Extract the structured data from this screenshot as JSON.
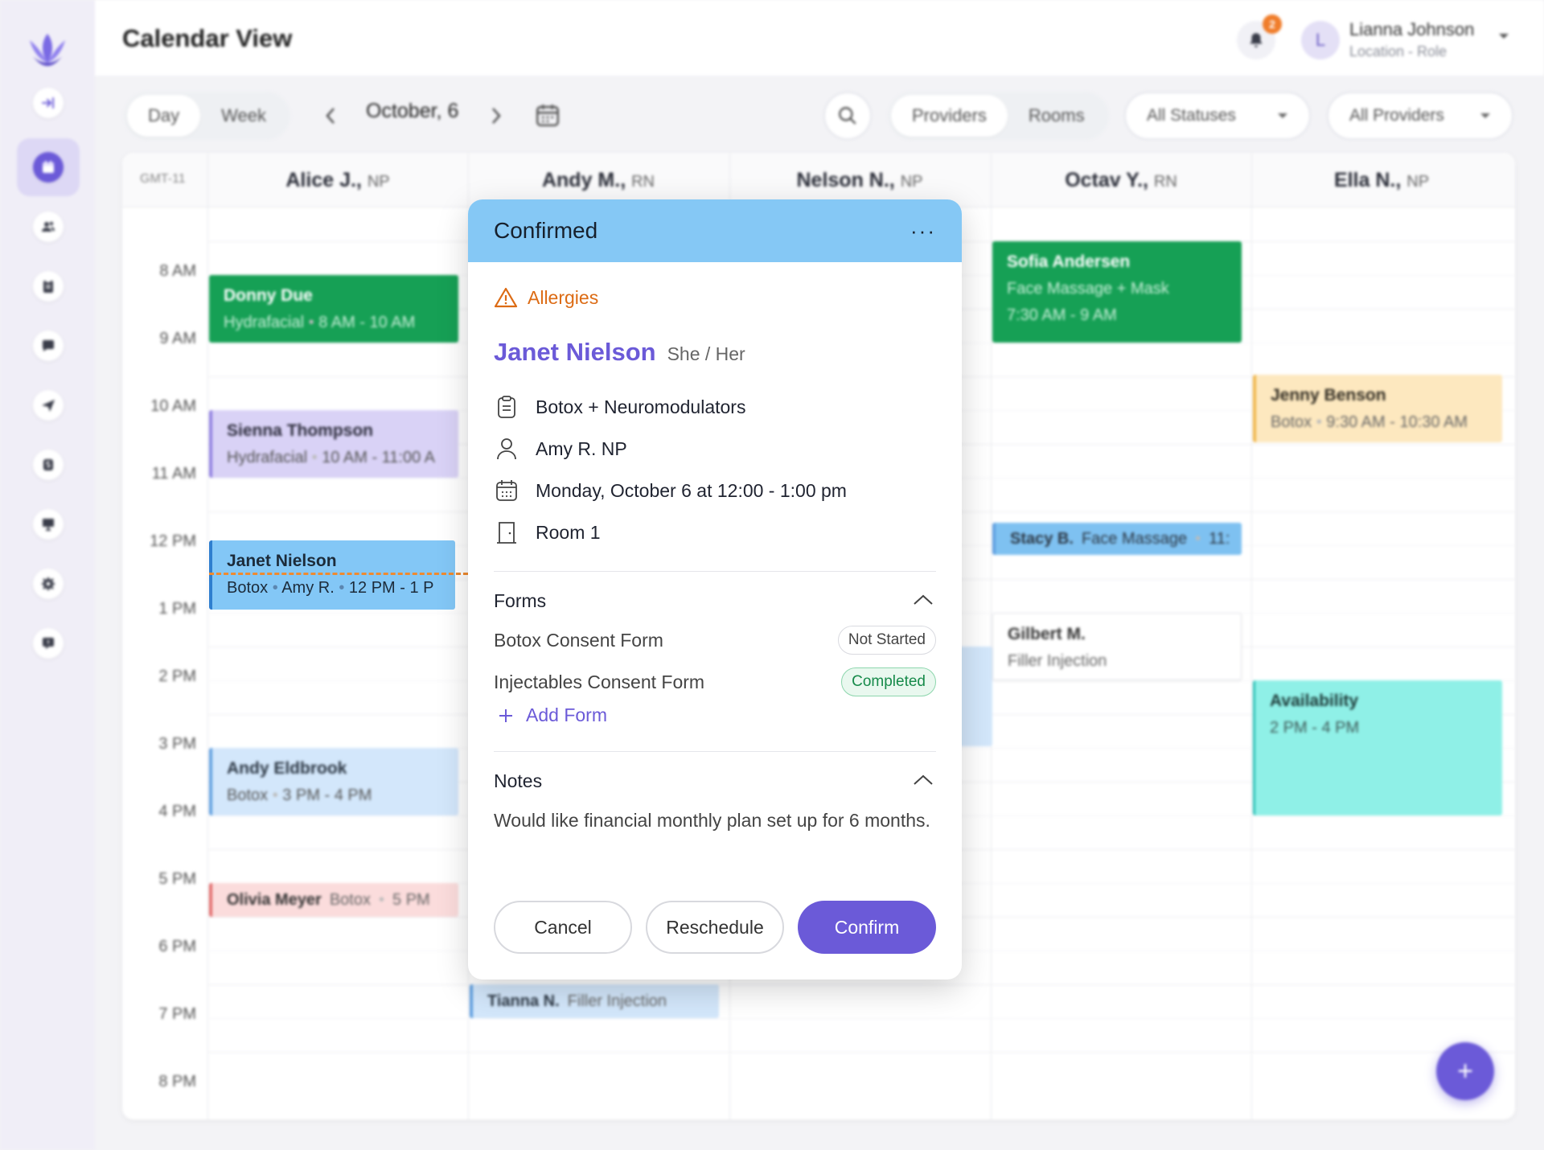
{
  "header": {
    "title": "Calendar View",
    "notification_count": "2",
    "user": {
      "initial": "L",
      "name": "Lianna Johnson",
      "role": "Location - Role"
    }
  },
  "toolbar": {
    "view_options": [
      "Day",
      "Week"
    ],
    "selected_view": "Day",
    "date": "October, 6",
    "resource_options": [
      "Providers",
      "Rooms"
    ],
    "selected_resource": "Providers",
    "status_filter": "All Statuses",
    "provider_filter": "All Providers"
  },
  "grid": {
    "timezone": "GMT-11",
    "columns": [
      {
        "name": "Alice J.,",
        "role": "NP"
      },
      {
        "name": "Andy M.,",
        "role": "RN"
      },
      {
        "name": "Nelson N.,",
        "role": "NP"
      },
      {
        "name": "Octav Y.,",
        "role": "RN"
      },
      {
        "name": "Ella N.,",
        "role": "NP"
      }
    ],
    "time_labels": [
      "8 AM",
      "9 AM",
      "10 AM",
      "11 AM",
      "12 PM",
      "1 PM",
      "2 PM",
      "3 PM",
      "4 PM",
      "5 PM",
      "6 PM",
      "7 PM",
      "8 PM"
    ]
  },
  "events": {
    "donny": {
      "name": "Donny Due",
      "service": "Hydrafacial",
      "time": "8 AM - 10 AM"
    },
    "sienna": {
      "name": "Sienna Thompson",
      "service": "Hydrafacial",
      "time": "10 AM - 11:00 A"
    },
    "janet": {
      "name": "Janet Nielson",
      "service": "Botox",
      "provider": "Amy R.",
      "time": "12 PM - 1 P"
    },
    "andy": {
      "name": "Andy Eldbrook",
      "service": "Botox",
      "time": "3 PM - 4 PM"
    },
    "olivia": {
      "name": "Olivia Meyer",
      "service": "Botox",
      "time": "5 PM"
    },
    "tianna": {
      "name": "Tianna N.",
      "service": "Filler Injection"
    },
    "sofia": {
      "name": "Sofia Andersen",
      "service": "Face Massage + Mask",
      "time": "7:30 AM - 9 AM"
    },
    "stacy": {
      "name": "Stacy B.",
      "service": "Face Massage",
      "time": "11:"
    },
    "gilbert": {
      "name": "Gilbert M.",
      "service": "Filler Injection"
    },
    "jenny": {
      "name": "Jenny Benson",
      "service": "Botox",
      "time": "9:30 AM - 10:30 AM"
    },
    "availability": {
      "name": "Availability",
      "time": "2 PM - 4 PM"
    }
  },
  "popup": {
    "status": "Confirmed",
    "more": "···",
    "alert": "Allergies",
    "patient_name": "Janet Nielson",
    "pronouns": "She / Her",
    "treatment": "Botox + Neuromodulators",
    "provider": "Amy R. NP",
    "datetime": "Monday, October 6 at 12:00 - 1:00 pm",
    "room": "Room 1",
    "forms_title": "Forms",
    "forms": [
      {
        "name": "Botox Consent Form",
        "status": "Not Started"
      },
      {
        "name": "Injectables Consent Form",
        "status": "Completed"
      }
    ],
    "add_form": "Add Form",
    "notes_title": "Notes",
    "notes": "Would like financial monthly plan set up for 6 months.",
    "buttons": {
      "cancel": "Cancel",
      "reschedule": "Reschedule",
      "confirm": "Confirm"
    }
  },
  "colors": {
    "accent": "#6b5ad8",
    "confirmed": "#85c8f5",
    "alert": "#dc6b14",
    "completed": "#168a4a"
  },
  "icons": {
    "sidebar": [
      "collapse-icon",
      "calendar-icon",
      "users-icon",
      "clipboard-icon",
      "chat-icon",
      "send-icon",
      "dollar-icon",
      "presentation-icon",
      "settings-icon",
      "support-icon"
    ]
  },
  "fab_label": "+"
}
